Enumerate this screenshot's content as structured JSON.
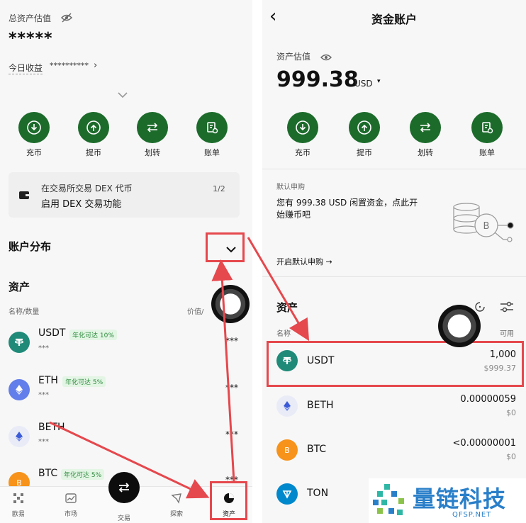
{
  "left": {
    "total_label": "总资产估值",
    "total_value": "*****",
    "today_label": "今日收益",
    "today_value": "**********",
    "actions": [
      {
        "label": "充币",
        "icon": "download-icon"
      },
      {
        "label": "提币",
        "icon": "upload-icon"
      },
      {
        "label": "划转",
        "icon": "transfer-icon"
      },
      {
        "label": "账单",
        "icon": "bill-icon"
      }
    ],
    "dex_banner": {
      "line1": "在交易所交易 DEX 代币",
      "line2": "启用 DEX 交易功能",
      "pager": "1/2"
    },
    "account_dist_label": "账户分布",
    "assets_label": "资产",
    "col_name": "名称/数量",
    "col_value": "价值/",
    "coins": [
      {
        "name": "USDT",
        "badge": "年化可达 10%",
        "amount": "***",
        "value": "***"
      },
      {
        "name": "ETH",
        "badge": "年化可达 5%",
        "amount": "***",
        "value": "***"
      },
      {
        "name": "BETH",
        "badge": "",
        "amount": "***",
        "value": "***"
      },
      {
        "name": "BTC",
        "badge": "年化可达 5%",
        "amount": "",
        "value": "***"
      }
    ],
    "nav": [
      {
        "label": "欧易",
        "icon": "grid-icon"
      },
      {
        "label": "市场",
        "icon": "chart-icon"
      },
      {
        "label": "交易",
        "icon": "swap-icon"
      },
      {
        "label": "探索",
        "icon": "compass-icon"
      },
      {
        "label": "资产",
        "icon": "pie-icon"
      }
    ]
  },
  "right": {
    "back": "‹",
    "title": "资金账户",
    "valuation_label": "资产估值",
    "valuation_value": "999.38",
    "valuation_unit": "USD",
    "actions": [
      {
        "label": "充币",
        "icon": "download-icon"
      },
      {
        "label": "提币",
        "icon": "upload-icon"
      },
      {
        "label": "划转",
        "icon": "transfer-icon"
      },
      {
        "label": "账单",
        "icon": "bill-icon"
      }
    ],
    "earn": {
      "label": "默认申购",
      "text1": "您有 999.38 USD 闲置资金，点此开",
      "text2": "始赚币吧",
      "cta": "开启默认申购 →"
    },
    "assets_label": "资产",
    "col_name": "名称",
    "col_avail": "可用",
    "coins": [
      {
        "name": "USDT",
        "amount": "1,000",
        "usd": "$999.37"
      },
      {
        "name": "BETH",
        "amount": "0.00000059",
        "usd": "$0"
      },
      {
        "name": "BTC",
        "amount": "<0.00000001",
        "usd": "$0"
      },
      {
        "name": "TON",
        "amount": "",
        "usd": ""
      }
    ]
  },
  "watermark": {
    "brand": "量链科技",
    "site": "QFSP.NET"
  },
  "colors": {
    "accent": "#1c6b2b",
    "highlight": "#e5484d",
    "badge_text": "#2d8a3e"
  }
}
